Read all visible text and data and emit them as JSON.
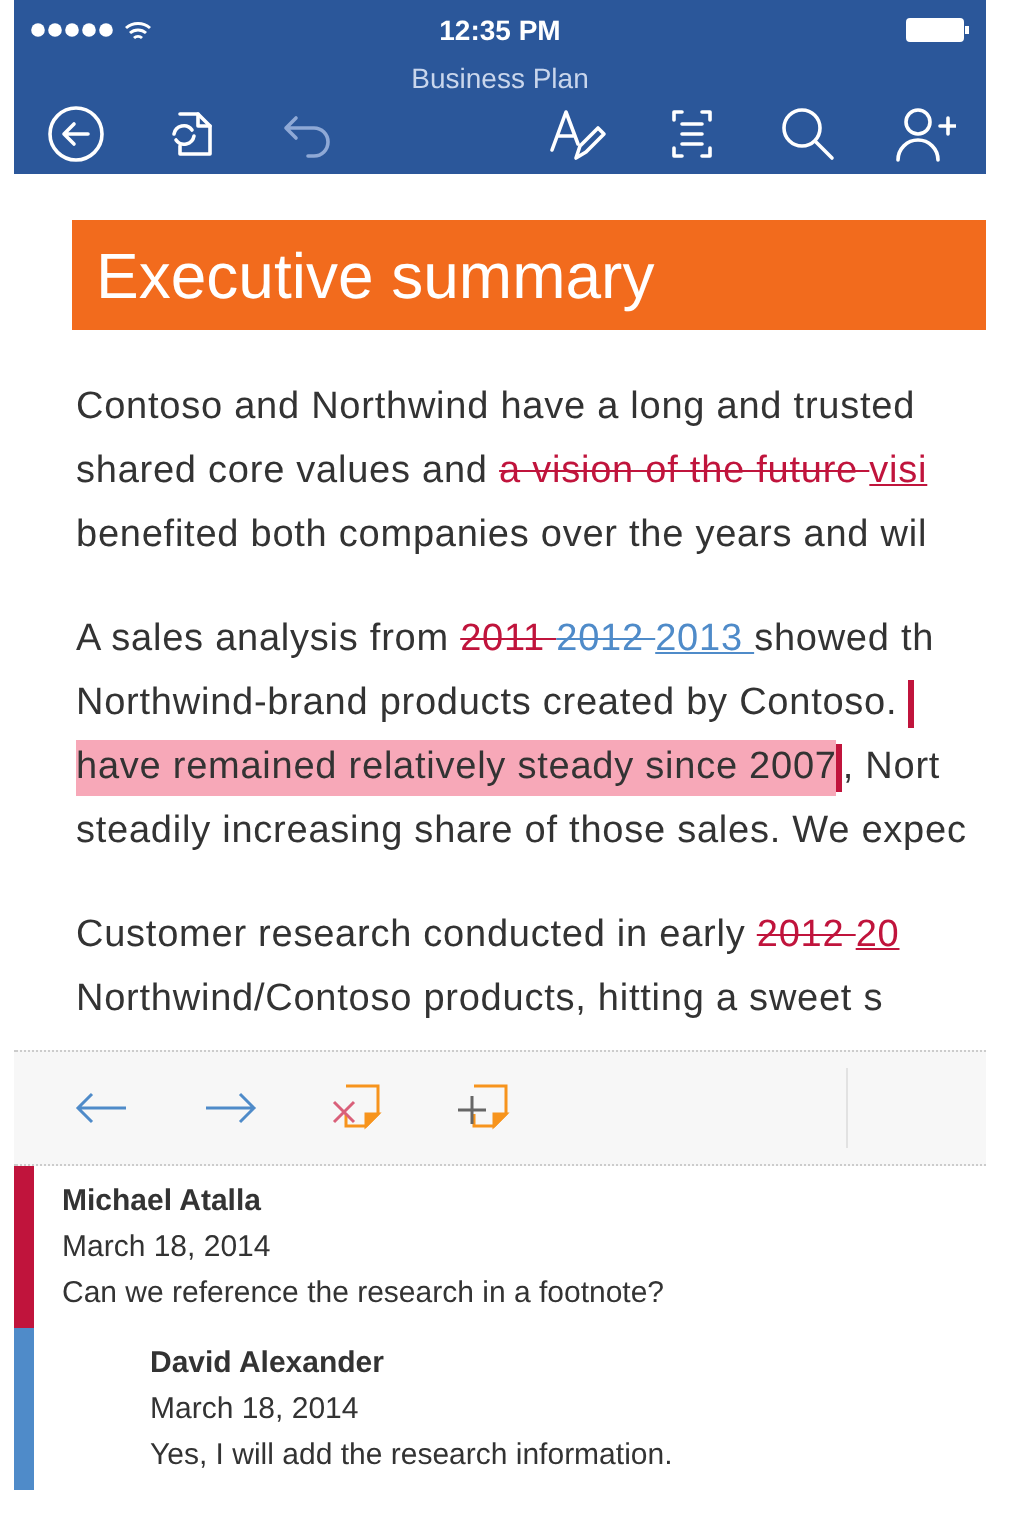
{
  "status_bar": {
    "time": "12:35 PM"
  },
  "window": {
    "title": "Business Plan"
  },
  "toolbar": [
    {
      "kind": "back",
      "disabled": false
    },
    {
      "kind": "sync",
      "disabled": false
    },
    {
      "kind": "undo",
      "disabled": true
    },
    {
      "kind": "spacer"
    },
    {
      "kind": "format",
      "disabled": false
    },
    {
      "kind": "reading",
      "disabled": false
    },
    {
      "kind": "search",
      "disabled": false
    },
    {
      "kind": "share",
      "disabled": false
    }
  ],
  "heading": "Executive summary",
  "paragraphs": [
    [
      [
        {
          "kind": "plain",
          "text": "Contoso and Northwind have a long and trusted"
        }
      ],
      [
        {
          "kind": "plain",
          "text": "shared core values and "
        },
        {
          "kind": "deleted",
          "text": "a vision of the future "
        },
        {
          "kind": "inserted",
          "text": "visi"
        }
      ],
      [
        {
          "kind": "plain",
          "text": "benefited both companies over the years and wil"
        }
      ]
    ],
    [
      [
        {
          "kind": "plain",
          "text": "A sales analysis from "
        },
        {
          "kind": "deleted",
          "text": "2011 "
        },
        {
          "kind": "deleted_blue",
          "text": "2012 "
        },
        {
          "kind": "inserted_blue",
          "text": "2013 "
        },
        {
          "kind": "plain",
          "text": "showed th"
        }
      ],
      [
        {
          "kind": "plain",
          "text": "Northwind-brand products created by Contoso. "
        },
        {
          "kind": "marker"
        }
      ],
      [
        {
          "kind": "highlight",
          "text": "have remained relatively steady since 2007"
        },
        {
          "kind": "marker"
        },
        {
          "kind": "plain",
          "text": ", Nort"
        }
      ],
      [
        {
          "kind": "plain",
          "text": "steadily increasing share of those sales. We expec"
        }
      ]
    ],
    [
      [
        {
          "kind": "plain",
          "text": "Customer research conducted in early "
        },
        {
          "kind": "deleted",
          "text": "2012 "
        },
        {
          "kind": "inserted",
          "text": "20"
        }
      ],
      [
        {
          "kind": "plain",
          "text": "Northwind/Contoso products, hitting a sweet s"
        }
      ]
    ]
  ],
  "review_bar": [
    {
      "kind": "previous"
    },
    {
      "kind": "next"
    },
    {
      "kind": "delete_comment"
    },
    {
      "kind": "new_comment"
    }
  ],
  "comments": [
    {
      "author": "Michael Atalla",
      "date": "March 18, 2014",
      "text": "Can we reference the research in a footnote?",
      "color": "#c0143c",
      "children": [
        {
          "author": "David Alexander",
          "date": "March 18, 2014",
          "text": "Yes, I will add the research information.",
          "color": "#4f8bc9"
        }
      ]
    }
  ]
}
